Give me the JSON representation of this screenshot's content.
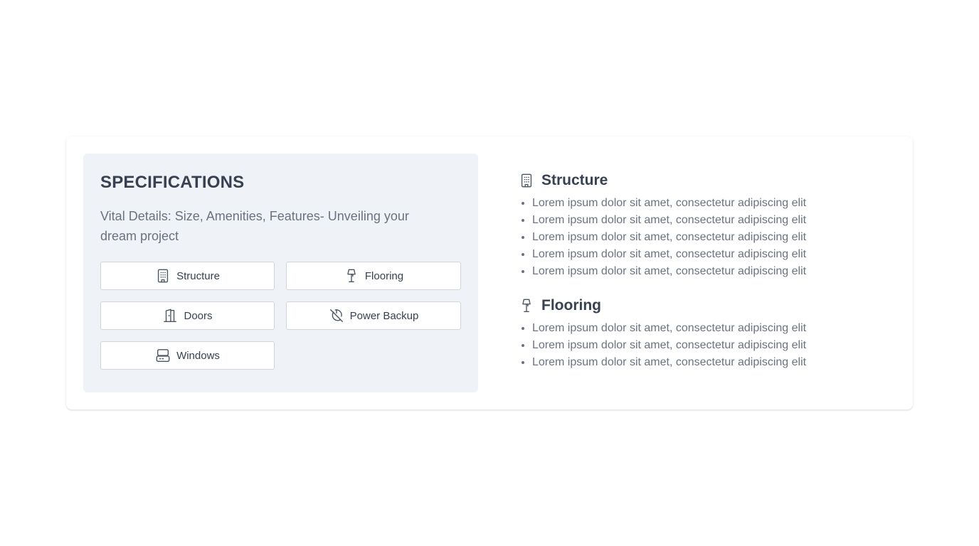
{
  "specifications": {
    "title": "SPECIFICATIONS",
    "subtitle": "Vital Details: Size, Amenities, Features- Unveiling your dream project",
    "buttons": [
      {
        "label": "Structure",
        "icon": "building-icon"
      },
      {
        "label": "Flooring",
        "icon": "lamp-icon"
      },
      {
        "label": "Doors",
        "icon": "door-icon"
      },
      {
        "label": "Power Backup",
        "icon": "power-off-icon"
      },
      {
        "label": "Windows",
        "icon": "window-icon"
      }
    ]
  },
  "details": {
    "sections": [
      {
        "title": "Structure",
        "icon": "building-icon",
        "items": [
          "Lorem ipsum dolor sit amet, consectetur adipiscing elit",
          "Lorem ipsum dolor sit amet, consectetur adipiscing elit",
          "Lorem ipsum dolor sit amet, consectetur adipiscing elit",
          "Lorem ipsum dolor sit amet, consectetur adipiscing elit",
          "Lorem ipsum dolor sit amet, consectetur adipiscing elit"
        ]
      },
      {
        "title": "Flooring",
        "icon": "lamp-icon",
        "items": [
          "Lorem ipsum dolor sit amet, consectetur adipiscing elit",
          "Lorem ipsum dolor sit amet, consectetur adipiscing elit",
          "Lorem ipsum dolor sit amet, consectetur adipiscing elit"
        ]
      }
    ]
  },
  "colors": {
    "panel_bg": "#eff2f6",
    "heading": "#374151",
    "muted_text": "#6b7280",
    "border": "#d1d5db"
  }
}
